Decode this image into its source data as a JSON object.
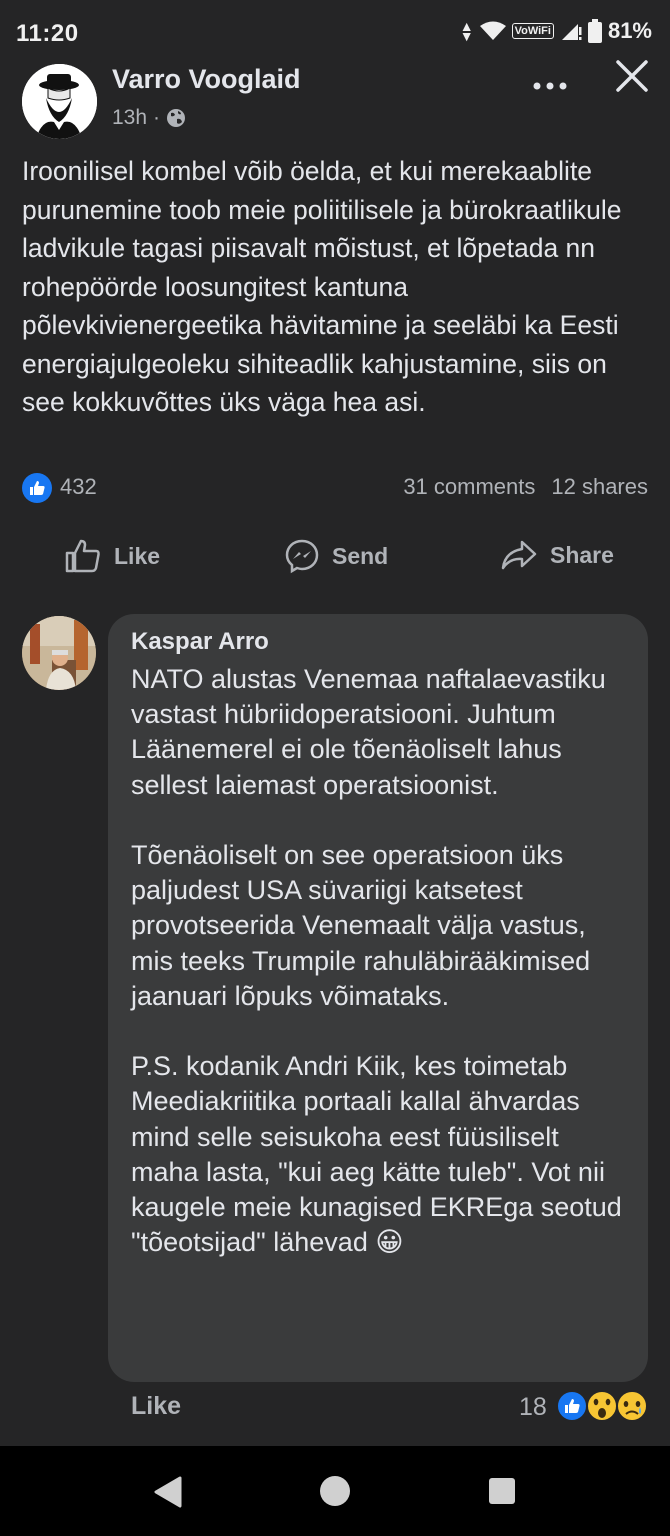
{
  "status_bar": {
    "time": "11:20",
    "vowifi_label": "VoWiFi",
    "battery": "81%"
  },
  "post": {
    "author": "Varro Vooglaid",
    "time": "13h",
    "separator": "·",
    "audience_icon": "globe-icon",
    "text": "Iroonilisel kombel võib öelda, et kui merekaablite purunemine toob meie poliitilisele ja bürokraatlikule ladvikule tagasi piisavalt mõistust, et lõpetada nn rohepöörde loosungitest kantuna põlevkivienergeetika hävitamine ja seeläbi ka Eesti energiajulgeoleku sihiteadlik kahjustamine, siis on see kokkuvõttes üks väga hea asi.",
    "reactions_count": "432",
    "comments": "31 comments",
    "shares": "12 shares"
  },
  "actions": {
    "like": "Like",
    "send": "Send",
    "share": "Share"
  },
  "comment": {
    "author": "Kaspar Arro",
    "paragraphs": [
      "NATO alustas Venemaa naftalaevastiku vastast hübriidoperatsiooni. Juhtum Läänemerel ei ole tõenäoliselt lahus sellest laiemast operatsioonist.",
      "Tõenäoliselt on see operatsioon üks paljudest USA süvariigi katsetest provotseerida Venemaalt välja vastus, mis teeks Trumpile rahuläbirääkimised jaanuari lõpuks võimataks.",
      "P.S. kodanik Andri Kiik, kes toimetab Meediakriitika portaali kallal ähvardas mind selle seisukoha eest füüsiliselt maha lasta, \"kui aeg kätte tuleb\". Vot nii kaugele meie kunagised EKREga seotud \"tõeotsijad\" lähevad 😀"
    ],
    "like_label": "Like",
    "reactions_count": "18"
  },
  "colors": {
    "background": "#252526",
    "bubble": "#3a3b3c",
    "accent_blue": "#1877f2",
    "text_primary": "#e4e6eb",
    "text_secondary": "#b0b3b8"
  }
}
